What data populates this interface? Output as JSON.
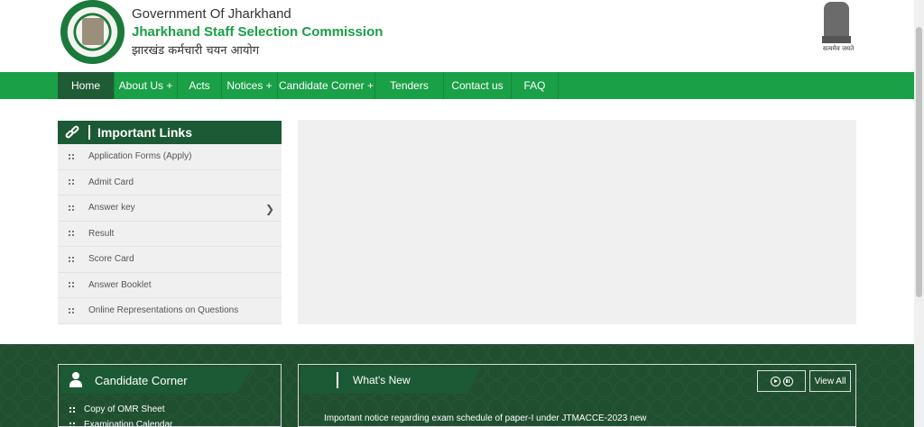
{
  "header": {
    "gov_title": "Government Of Jharkhand",
    "org_title": "Jharkhand Staff Selection Commission",
    "hindi_title": "झारखंड कर्मचारी चयन आयोग",
    "emblem_motto": "सत्यमेव जयते"
  },
  "nav": {
    "items": [
      {
        "label": "Home",
        "active": true
      },
      {
        "label": "About Us +"
      },
      {
        "label": "Acts"
      },
      {
        "label": "Notices +"
      },
      {
        "label": "Candidate Corner +"
      },
      {
        "label": "Tenders"
      },
      {
        "label": "Contact us"
      },
      {
        "label": "FAQ"
      }
    ]
  },
  "important_links": {
    "title": "Important Links",
    "items": [
      {
        "label": "Application Forms (Apply)"
      },
      {
        "label": "Admit Card"
      },
      {
        "label": "Answer key",
        "has_submenu": true
      },
      {
        "label": "Result"
      },
      {
        "label": "Score Card"
      },
      {
        "label": "Answer Booklet"
      },
      {
        "label": "Online Representations on Questions"
      }
    ]
  },
  "candidate_corner": {
    "title": "Candidate Corner",
    "items": [
      "Copy of OMR Sheet",
      "Examination Calendar"
    ]
  },
  "whats_new": {
    "title": "What's New",
    "view_all": "View All",
    "ticker": "Important notice regarding exam schedule of paper-I under JTMACCE-2023 new"
  },
  "colors": {
    "primary_green": "#1aa047",
    "dark_green": "#1b5a34",
    "band_green": "#1f4f2f"
  }
}
